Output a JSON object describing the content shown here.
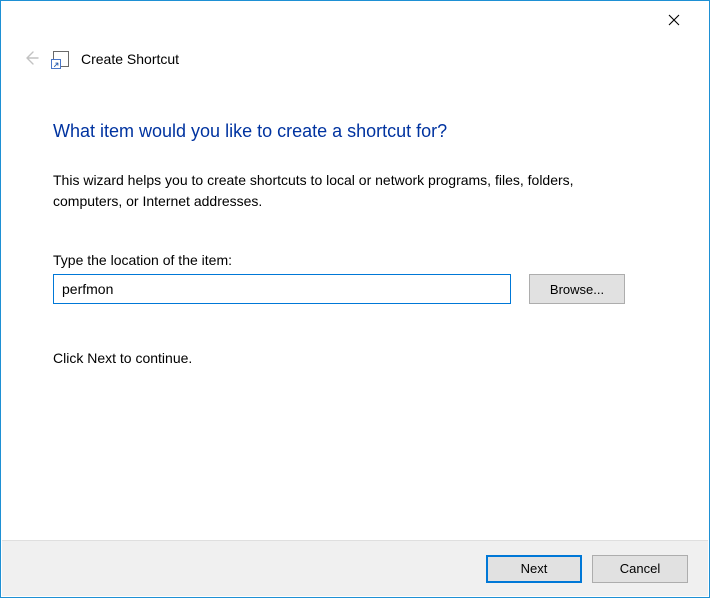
{
  "titlebar": {
    "close_label": "Close"
  },
  "header": {
    "wizard_title": "Create Shortcut"
  },
  "main": {
    "heading": "What item would you like to create a shortcut for?",
    "description": "This wizard helps you to create shortcuts to local or network programs, files, folders, computers, or Internet addresses.",
    "location_label": "Type the location of the item:",
    "location_value": "perfmon",
    "browse_label": "Browse...",
    "continue_text": "Click Next to continue."
  },
  "footer": {
    "next_label": "Next",
    "cancel_label": "Cancel"
  }
}
